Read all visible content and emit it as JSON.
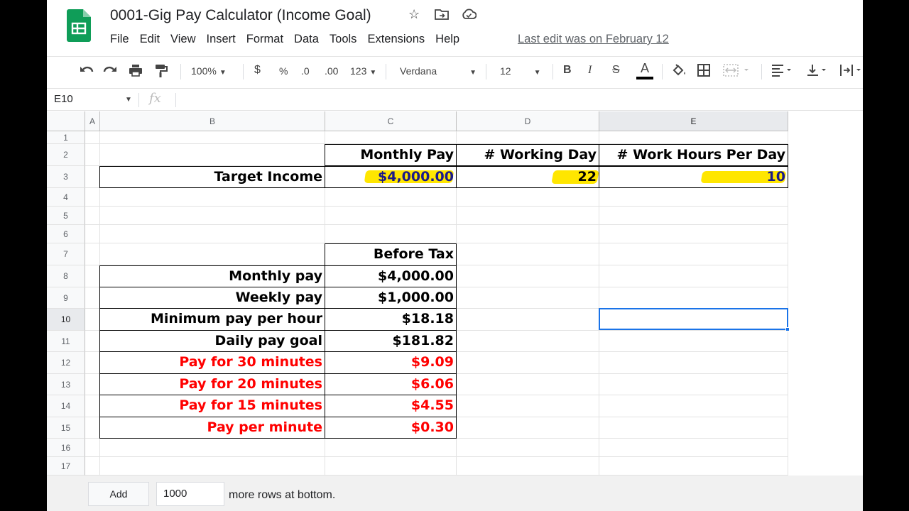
{
  "app": {
    "doc_title": "0001-Gig Pay Calculator (Income Goal)",
    "last_edit": "Last edit was on February 12",
    "accent_color": "#1a73e8",
    "logo_color": "#0f9d58"
  },
  "menu": [
    "File",
    "Edit",
    "View",
    "Insert",
    "Format",
    "Data",
    "Tools",
    "Extensions",
    "Help"
  ],
  "toolbar": {
    "zoom": "100%",
    "currency": "$",
    "percent": "%",
    "dec_decrease": ".0",
    "dec_increase": ".00",
    "more_formats": "123",
    "font": "Verdana",
    "font_size": "12",
    "bold": "B",
    "italic": "I",
    "strike": "S",
    "text_color": "A"
  },
  "formula_bar": {
    "name_box": "E10",
    "fx": "fx",
    "formula": ""
  },
  "grid": {
    "columns": [
      "A",
      "B",
      "C",
      "D",
      "E"
    ],
    "rows": [
      "1",
      "2",
      "3",
      "4",
      "5",
      "6",
      "7",
      "8",
      "9",
      "10",
      "11",
      "12",
      "13",
      "14",
      "15",
      "16",
      "17"
    ],
    "selected_cell": "E10"
  },
  "cells": {
    "c2": "Monthly Pay",
    "d2": "# Working Day",
    "e2": "# Work Hours Per Day",
    "b3": "Target Income",
    "c3": "$4,000.00",
    "d3": "22",
    "e3": "10",
    "c7": "Before Tax",
    "b8": "Monthly pay",
    "c8": "$4,000.00",
    "b9": "Weekly pay",
    "c9": "$1,000.00",
    "b10": "Minimum pay per hour",
    "c10": "$18.18",
    "b11": "Daily pay goal",
    "c11": "$181.82",
    "b12": "Pay for 30 minutes",
    "c12": "$9.09",
    "b13": "Pay for 20 minutes",
    "c13": "$6.06",
    "b14": "Pay for 15 minutes",
    "c14": "$4.55",
    "b15": "Pay per minute",
    "c15": "$0.30"
  },
  "bottom": {
    "add_label": "Add",
    "rows_value": "1000",
    "rows_suffix": "more rows at bottom."
  }
}
